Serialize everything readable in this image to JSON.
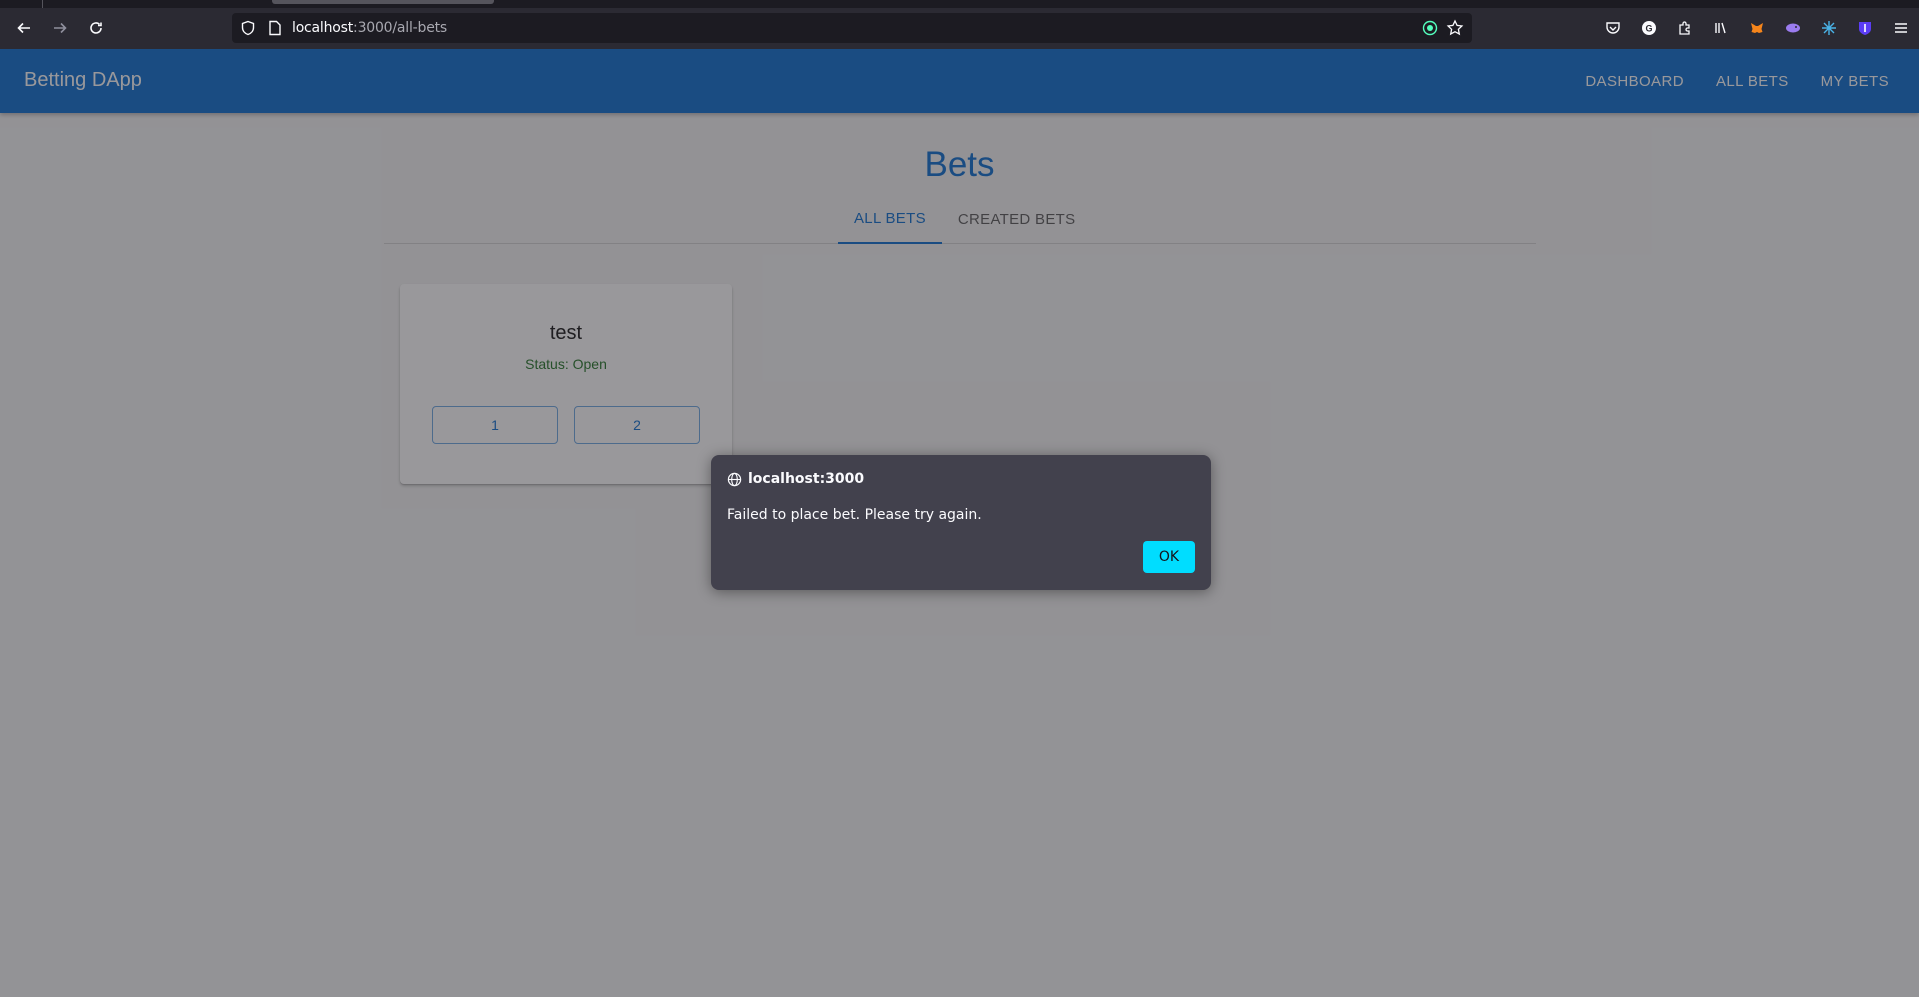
{
  "browser": {
    "url_host": "localhost",
    "url_path": ":3000/all-bets",
    "toolbar_icons": [
      "pocket-icon",
      "account-icon",
      "extensions-icon",
      "library-icon",
      "metamask-icon",
      "extension-icon",
      "extension-icon",
      "extension-icon",
      "menu-icon"
    ]
  },
  "appbar": {
    "brand": "Betting DApp",
    "nav": [
      "DASHBOARD",
      "ALL BETS",
      "MY BETS"
    ],
    "color": "#1976d2"
  },
  "main": {
    "title": "Bets",
    "tabs": [
      {
        "label": "ALL BETS",
        "active": true
      },
      {
        "label": "CREATED BETS",
        "active": false
      }
    ],
    "bets": [
      {
        "title": "test",
        "status": "Status: Open",
        "options": [
          "1",
          "2"
        ]
      }
    ]
  },
  "dialog": {
    "origin": "localhost:3000",
    "message": "Failed to place bet. Please try again.",
    "ok_label": "OK",
    "button_color": "#00ddff"
  }
}
